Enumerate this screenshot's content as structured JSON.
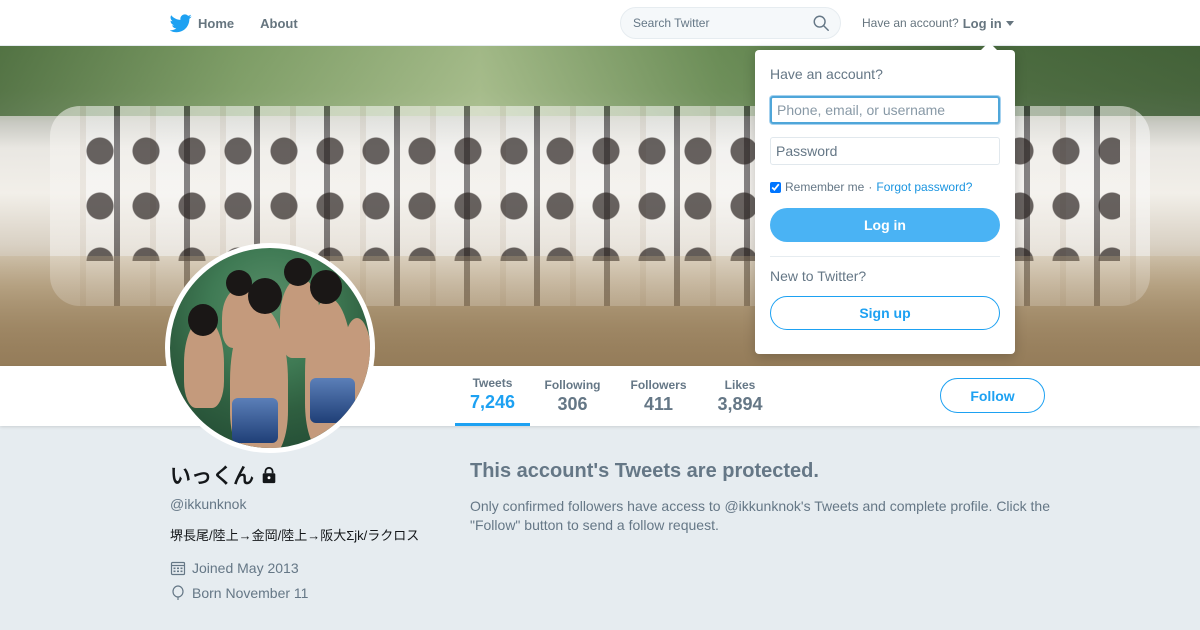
{
  "colors": {
    "accent": "#1da1f2",
    "muted": "#657786",
    "background": "#e6ecf0",
    "login_button": "#4ab3f4"
  },
  "topnav": {
    "home_label": "Home",
    "about_label": "About",
    "search_placeholder": "Search Twitter",
    "have_account": "Have an account?",
    "login_label": "Log in"
  },
  "stats": [
    {
      "label": "Tweets",
      "value": "7,246",
      "active": true
    },
    {
      "label": "Following",
      "value": "306",
      "active": false
    },
    {
      "label": "Followers",
      "value": "411",
      "active": false
    },
    {
      "label": "Likes",
      "value": "3,894",
      "active": false
    }
  ],
  "follow_label": "Follow",
  "profile": {
    "name": "いっくん",
    "handle": "@ikkunknok",
    "bio": "堺長尾/陸上→金岡/陸上→阪大Σjk/ラクロス",
    "joined": "Joined May 2013",
    "born": "Born November 11"
  },
  "protected": {
    "title": "This account's Tweets are protected.",
    "body": "Only confirmed followers have access to @ikkunknok's Tweets and complete profile. Click the \"Follow\" button to send a follow request."
  },
  "dropdown": {
    "title": "Have an account?",
    "username_placeholder": "Phone, email, or username",
    "password_placeholder": "Password",
    "remember_label": "Remember me",
    "separator": " · ",
    "forgot_label": "Forgot password?",
    "login_button": "Log in",
    "new_prompt": "New to Twitter?",
    "signup_button": "Sign up"
  }
}
